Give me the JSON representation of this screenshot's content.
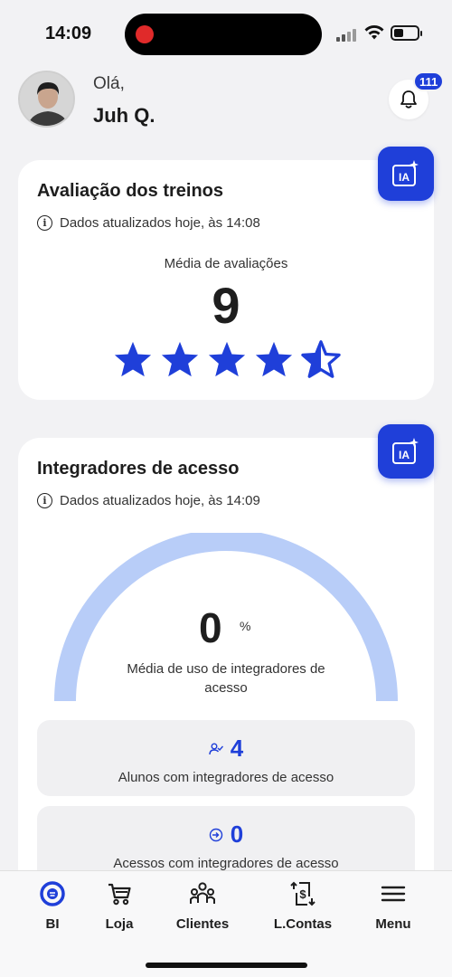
{
  "status_bar": {
    "time": "14:09",
    "icons": [
      "signal-icon",
      "wifi-icon",
      "battery-icon"
    ]
  },
  "header": {
    "greeting": "Olá,",
    "user_name": "Juh Q.",
    "notification_count": "111",
    "icons": [
      "avatar",
      "bell-icon"
    ]
  },
  "evaluation_card": {
    "title": "Avaliação dos treinos",
    "updated": "Dados atualizados hoje, às 14:08",
    "avg_label": "Média de avaliações",
    "score": "9",
    "stars": {
      "filled": 4,
      "half": 1,
      "total": 5
    },
    "ia_button_icon": "ia-sparkle-icon"
  },
  "access_card": {
    "title": "Integradores de acesso",
    "updated": "Dados atualizados hoje, às 14:09",
    "percent_value": "0",
    "percent_symbol": "%",
    "gauge_label": "Média de uso de integradores de acesso",
    "gauge_fill_fraction": 0,
    "ia_button_icon": "ia-sparkle-icon",
    "stats": [
      {
        "value": "4",
        "label": "Alunos com integradores de acesso",
        "icon": "user-check-icon"
      },
      {
        "value": "0",
        "label": "Acessos com integradores de acesso",
        "icon": "login-icon"
      }
    ]
  },
  "bottom_nav": {
    "items": [
      {
        "label": "BI",
        "icon": "bi-icon"
      },
      {
        "label": "Loja",
        "icon": "cart-icon"
      },
      {
        "label": "Clientes",
        "icon": "clients-icon"
      },
      {
        "label": "L.Contas",
        "icon": "accounts-icon"
      },
      {
        "label": "Menu",
        "icon": "menu-icon"
      }
    ]
  },
  "colors": {
    "accent": "#1f3fd9",
    "gauge_track": "#b8cdf8",
    "background": "#f2f2f4"
  }
}
